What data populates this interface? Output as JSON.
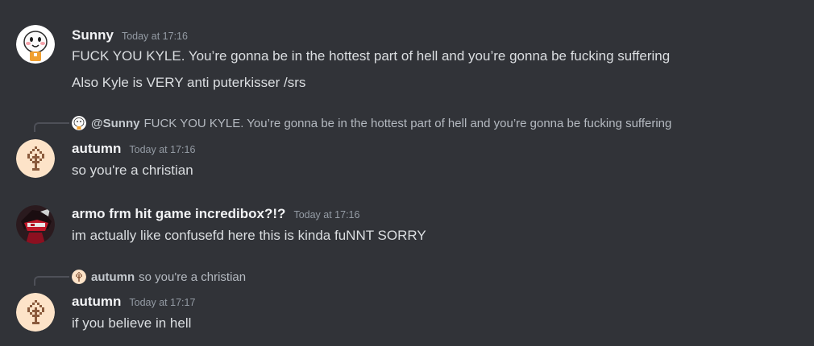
{
  "messages": [
    {
      "username": "Sunny",
      "timestamp": "Today at 17:16",
      "lines": [
        "FUCK YOU KYLE. You’re gonna be in the hottest part of hell and you’re gonna be fucking suffering",
        "Also Kyle is VERY anti puterkisser /srs"
      ],
      "avatar_icon": "white-blob-avatar-icon"
    },
    {
      "reply": {
        "username": "@Sunny",
        "text": "FUCK YOU KYLE. You’re gonna be in the hottest part of hell and you’re gonna be fucking suffering"
      },
      "username": "autumn",
      "timestamp": "Today at 17:16",
      "lines": [
        "so you're a christian"
      ],
      "avatar_icon": "pixel-tree-avatar-icon"
    },
    {
      "username": "armo frm hit game incredibox?!?",
      "timestamp": "Today at 17:16",
      "lines": [
        "im actually like confusefd here this is kinda fuNNT SORRY"
      ],
      "avatar_icon": "red-character-avatar-icon"
    },
    {
      "reply": {
        "username": "autumn",
        "text": "so you're a christian"
      },
      "username": "autumn",
      "timestamp": "Today at 17:17",
      "lines": [
        "if you believe in hell"
      ],
      "avatar_icon": "pixel-tree-avatar-icon"
    }
  ],
  "colors": {
    "background": "#313338",
    "username": "#f2f3f5",
    "text": "#dbdee1",
    "timestamp": "#949ba4",
    "reply_spine": "#4e5058"
  }
}
